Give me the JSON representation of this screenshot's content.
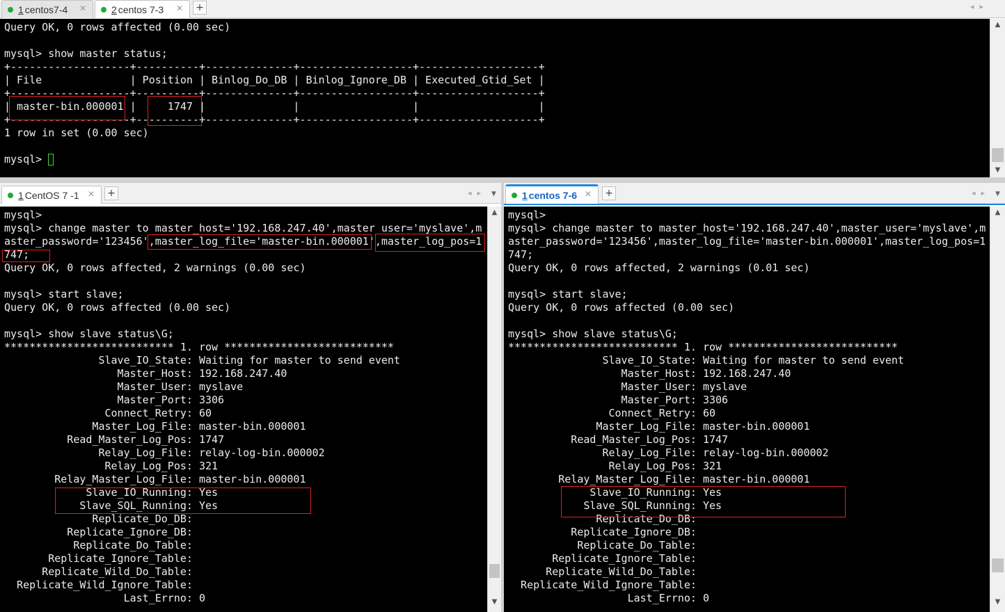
{
  "top_tabs": [
    {
      "num": "1",
      "name": "centos7-4",
      "active": false
    },
    {
      "num": "2",
      "name": "centos 7-3",
      "active": true
    }
  ],
  "left_tab": {
    "num": "1",
    "name": "CentOS 7 -1"
  },
  "right_tab": {
    "num": "1",
    "name": "centos 7-6"
  },
  "add_tab_label": "+",
  "close_glyph": "✕",
  "icons": {
    "add": "plus-icon",
    "close": "close-icon",
    "scroll_up": "arrow-up-icon",
    "scroll_down": "arrow-down-icon",
    "tab_left": "chevron-left-icon",
    "tab_right": "chevron-right-icon",
    "tab_menu": "chevron-down-icon"
  },
  "colors": {
    "terminal_bg": "#000000",
    "terminal_fg": "#ececec",
    "highlight": "#e02020",
    "cursor": "#3cdc3c",
    "status_dot": "#1faa3a",
    "focus": "#1e88e5"
  },
  "top_terminal": {
    "lines": [
      "Query OK, 0 rows affected (0.00 sec)",
      "",
      "mysql> show master status;",
      "+-------------------+----------+--------------+------------------+-------------------+",
      "| File              | Position | Binlog_Do_DB | Binlog_Ignore_DB | Executed_Gtid_Set |",
      "+-------------------+----------+--------------+------------------+-------------------+",
      "| master-bin.000001 |     1747 |              |                  |                   |",
      "+-------------------+----------+--------------+------------------+-------------------+",
      "1 row in set (0.00 sec)",
      ""
    ],
    "prompt": "mysql> "
  },
  "left_terminal": {
    "lines": [
      "mysql>",
      "mysql> change master to master_host='192.168.247.40',master_user='myslave',m",
      "aster_password='123456',master_log_file='master-bin.000001',master_log_pos=1",
      "747;",
      "Query OK, 0 rows affected, 2 warnings (0.00 sec)",
      "",
      "mysql> start slave;",
      "Query OK, 0 rows affected (0.00 sec)",
      "",
      "mysql> show slave status\\G;",
      "*************************** 1. row ***************************",
      "               Slave_IO_State: Waiting for master to send event",
      "                  Master_Host: 192.168.247.40",
      "                  Master_User: myslave",
      "                  Master_Port: 3306",
      "                Connect_Retry: 60",
      "              Master_Log_File: master-bin.000001",
      "          Read_Master_Log_Pos: 1747",
      "               Relay_Log_File: relay-log-bin.000002",
      "                Relay_Log_Pos: 321",
      "        Relay_Master_Log_File: master-bin.000001",
      "             Slave_IO_Running: Yes",
      "            Slave_SQL_Running: Yes",
      "              Replicate_Do_DB: ",
      "          Replicate_Ignore_DB: ",
      "           Replicate_Do_Table: ",
      "       Replicate_Ignore_Table: ",
      "      Replicate_Wild_Do_Table: ",
      "  Replicate_Wild_Ignore_Table: ",
      "                   Last_Errno: 0"
    ]
  },
  "right_terminal": {
    "lines": [
      "mysql>",
      "mysql> change master to master_host='192.168.247.40',master_user='myslave',m",
      "aster_password='123456',master_log_file='master-bin.000001',master_log_pos=1",
      "747;",
      "Query OK, 0 rows affected, 2 warnings (0.01 sec)",
      "",
      "mysql> start slave;",
      "Query OK, 0 rows affected (0.00 sec)",
      "",
      "mysql> show slave status\\G;",
      "*************************** 1. row ***************************",
      "               Slave_IO_State: Waiting for master to send event",
      "                  Master_Host: 192.168.247.40",
      "                  Master_User: myslave",
      "                  Master_Port: 3306",
      "                Connect_Retry: 60",
      "              Master_Log_File: master-bin.000001",
      "          Read_Master_Log_Pos: 1747",
      "               Relay_Log_File: relay-log-bin.000002",
      "                Relay_Log_Pos: 321",
      "        Relay_Master_Log_File: master-bin.000001",
      "             Slave_IO_Running: Yes",
      "            Slave_SQL_Running: Yes",
      "              Replicate_Do_DB: ",
      "          Replicate_Ignore_DB: ",
      "           Replicate_Do_Table: ",
      "       Replicate_Ignore_Table: ",
      "      Replicate_Wild_Do_Table: ",
      "  Replicate_Wild_Ignore_Table: ",
      "                   Last_Errno: 0"
    ]
  }
}
